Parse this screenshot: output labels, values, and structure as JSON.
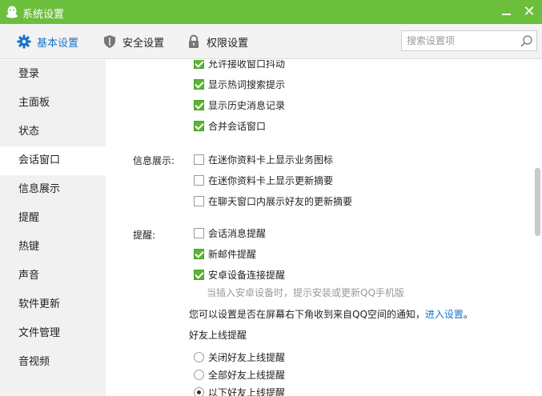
{
  "window": {
    "title": "系统设置",
    "close_glyph": "✕"
  },
  "tabs": [
    {
      "label": "基本设置",
      "icon": "gear-icon",
      "active": true
    },
    {
      "label": "安全设置",
      "icon": "shield-icon",
      "active": false
    },
    {
      "label": "权限设置",
      "icon": "lock-icon",
      "active": false
    }
  ],
  "search": {
    "placeholder": "搜索设置项",
    "value": ""
  },
  "sidebar": {
    "items": [
      {
        "label": "登录"
      },
      {
        "label": "主面板"
      },
      {
        "label": "状态"
      },
      {
        "label": "会话窗口",
        "active": true
      },
      {
        "label": "信息展示"
      },
      {
        "label": "提醒"
      },
      {
        "label": "热键"
      },
      {
        "label": "声音"
      },
      {
        "label": "软件更新"
      },
      {
        "label": "文件管理"
      },
      {
        "label": "音视频"
      }
    ]
  },
  "session": {
    "options": [
      {
        "label": "允许接收窗口抖动",
        "checked": true
      },
      {
        "label": "显示热词搜索提示",
        "checked": true
      },
      {
        "label": "显示历史消息记录",
        "checked": true
      },
      {
        "label": "合并会话窗口",
        "checked": true
      }
    ]
  },
  "info_display": {
    "label": "信息展示:",
    "options": [
      {
        "label": "在迷你资料卡上显示业务图标",
        "checked": false
      },
      {
        "label": "在迷你资料卡上显示更新摘要",
        "checked": false
      },
      {
        "label": "在聊天窗口内展示好友的更新摘要",
        "checked": false
      }
    ]
  },
  "reminder": {
    "label": "提醒:",
    "options": [
      {
        "label": "会话消息提醒",
        "checked": false
      },
      {
        "label": "新邮件提醒",
        "checked": true
      },
      {
        "label": "安卓设备连接提醒",
        "checked": true
      }
    ],
    "hint": "当插入安卓设备时，提示安装或更新QQ手机版",
    "qzone_notice": "您可以设置是否在屏幕右下角收到来自QQ空间的通知，",
    "qzone_link": "进入设置",
    "qzone_period": "。"
  },
  "friend_online": {
    "label": "好友上线提醒",
    "options": [
      {
        "label": "关闭好友上线提醒",
        "selected": false
      },
      {
        "label": "全部好友上线提醒",
        "selected": false
      },
      {
        "label": "以下好友上线提醒",
        "selected": true
      }
    ]
  },
  "colors": {
    "titlebar": "#6cbf3d",
    "accent": "#1a73c8",
    "checkbox_on": "#5cb531"
  }
}
